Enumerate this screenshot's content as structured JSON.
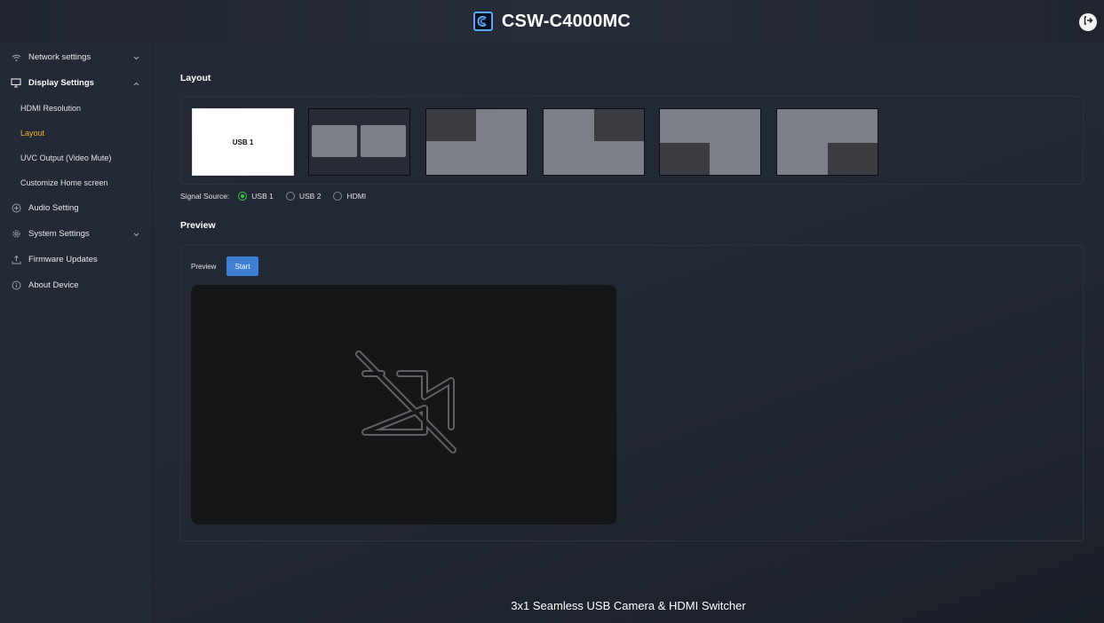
{
  "header": {
    "title": "CSW-C4000MC"
  },
  "sidebar": {
    "items": [
      {
        "label": "Network settings"
      },
      {
        "label": "Display Settings"
      },
      {
        "label": "Audio Setting"
      },
      {
        "label": "System Settings"
      },
      {
        "label": "Firmware Updates"
      },
      {
        "label": "About Device"
      }
    ],
    "display_sub": [
      {
        "label": "HDMI Resolution"
      },
      {
        "label": "Layout"
      },
      {
        "label": "UVC Output (Video Mute)"
      },
      {
        "label": "Customize Home screen"
      }
    ]
  },
  "main": {
    "layout_heading": "Layout",
    "layout_single_label": "USB 1",
    "signal_source": {
      "label": "Signal Source:",
      "options": [
        "USB 1",
        "USB 2",
        "HDMI"
      ],
      "selected": "USB 1"
    },
    "preview_heading": "Preview",
    "preview_label": "Preview",
    "start_label": "Start",
    "footer": "3x1 Seamless USB Camera & HDMI Switcher"
  },
  "colors": {
    "active_nav": "#f5b32b",
    "accent_blue": "#3f7fd6",
    "radio_green": "#41c64b"
  },
  "icons": [
    "wifi-icon",
    "monitor-icon",
    "plus-circle-icon",
    "gear-icon",
    "upload-icon",
    "info-icon",
    "logout-icon",
    "video-off-icon",
    "chevron-down-icon",
    "chevron-up-icon"
  ]
}
